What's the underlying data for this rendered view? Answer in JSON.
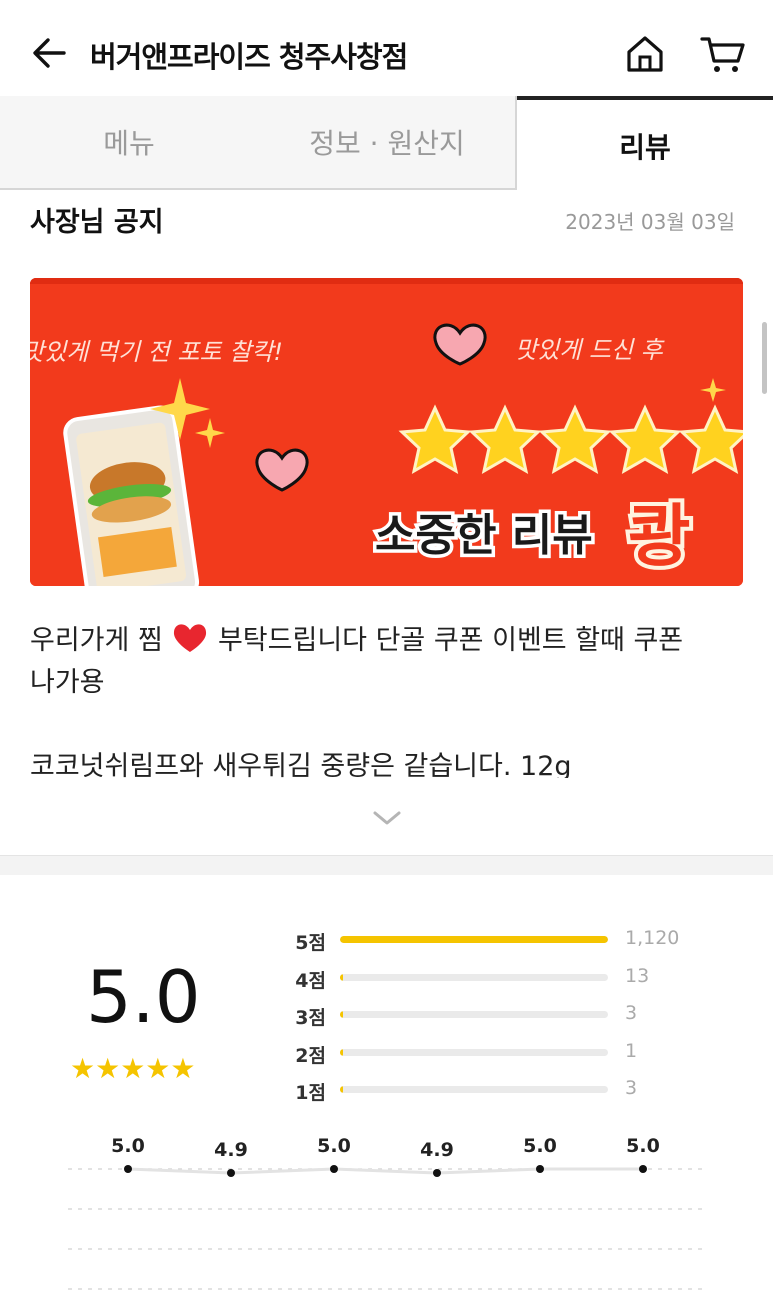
{
  "header": {
    "title": "버거앤프라이즈 청주사창점",
    "back_icon": "arrow-left-icon",
    "home_icon": "home-icon",
    "cart_icon": "cart-icon"
  },
  "tabs": [
    {
      "label": "메뉴",
      "active": false
    },
    {
      "label": "정보 · 원산지",
      "active": false
    },
    {
      "label": "리뷰",
      "active": true
    }
  ],
  "notice": {
    "title": "사장님 공지",
    "date": "2023년 03월 03일",
    "banner": {
      "text_left": "맛있게 먹기 전 포토 찰칵!",
      "text_right": "맛있게 드신 후",
      "headline": "소중한 리뷰",
      "headline_tail": "쾅",
      "background": "#f23a1c"
    },
    "body_line1_pre": "우리가게 찜 ",
    "body_line1_post": " 부탁드립니다 단골 쿠폰 이벤트 할때 쿠폰",
    "body_line2": "나가용",
    "body_line3": "코코넛쉬림프와 새우튀김 중량은 같습니다. 12g",
    "expand_icon": "chevron-down-icon"
  },
  "rating": {
    "average": "5.0",
    "stars": "★★★★★",
    "accent": "#f5c400",
    "distribution": [
      {
        "label": "5점",
        "count": "1,120",
        "value": 1120
      },
      {
        "label": "4점",
        "count": "13",
        "value": 13
      },
      {
        "label": "3점",
        "count": "3",
        "value": 3
      },
      {
        "label": "2점",
        "count": "1",
        "value": 1
      },
      {
        "label": "1점",
        "count": "3",
        "value": 3
      }
    ],
    "trend": [
      "5.0",
      "4.9",
      "5.0",
      "4.9",
      "5.0",
      "5.0"
    ]
  }
}
